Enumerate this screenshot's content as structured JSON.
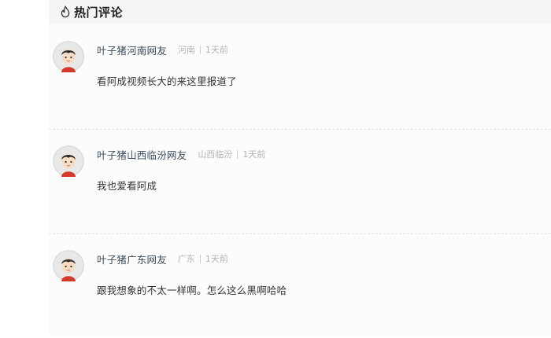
{
  "header": {
    "title": "热门评论",
    "icon": "flame-icon"
  },
  "comments": [
    {
      "username": "叶子猪河南网友",
      "location": "河南",
      "time": "1天前",
      "text": "看阿成视频长大的来这里报道了"
    },
    {
      "username": "叶子猪山西临汾网友",
      "location": "山西临汾",
      "time": "1天前",
      "text": "我也爱看阿成"
    },
    {
      "username": "叶子猪广东网友",
      "location": "广东",
      "time": "1天前",
      "text": "跟我想象的不太一样啊。怎么这么黑啊哈哈"
    }
  ],
  "colors": {
    "username": "#3a4a5a",
    "meta": "#b4b4b4",
    "text": "#333333",
    "header_bg": "#f4f5f6"
  }
}
